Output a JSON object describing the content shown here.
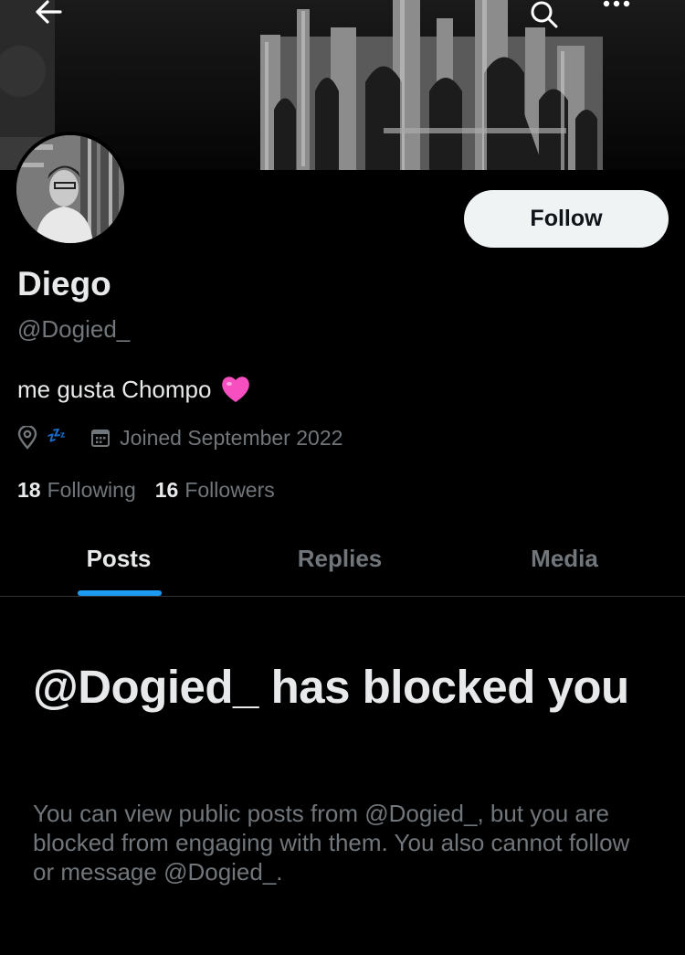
{
  "header": {
    "back_icon": "back-arrow-icon",
    "search_icon": "search-icon",
    "more_icon": "more-dots-icon"
  },
  "profile": {
    "display_name": "Diego",
    "handle": "@Dogied_",
    "bio": "me gusta Chompo",
    "bio_emoji": "pink-heart-icon",
    "location": "💤",
    "joined": "Joined September 2022",
    "following_count": "18",
    "following_label": "Following",
    "followers_count": "16",
    "followers_label": "Followers",
    "follow_label": "Follow"
  },
  "tabs": [
    {
      "label": "Posts",
      "active": true
    },
    {
      "label": "Replies",
      "active": false
    },
    {
      "label": "Media",
      "active": false
    }
  ],
  "blocked": {
    "title": "@Dogied_ has blocked you",
    "description": "You can view public posts from @Dogied_, but you are blocked from engaging with them. You also cannot follow or message @Dogied_."
  },
  "colors": {
    "background": "#000000",
    "text_primary": "#e7e9ea",
    "text_secondary": "#71767b",
    "accent": "#1d9bf0",
    "follow_button_bg": "#eff3f4",
    "heart": "#f74fc0"
  }
}
